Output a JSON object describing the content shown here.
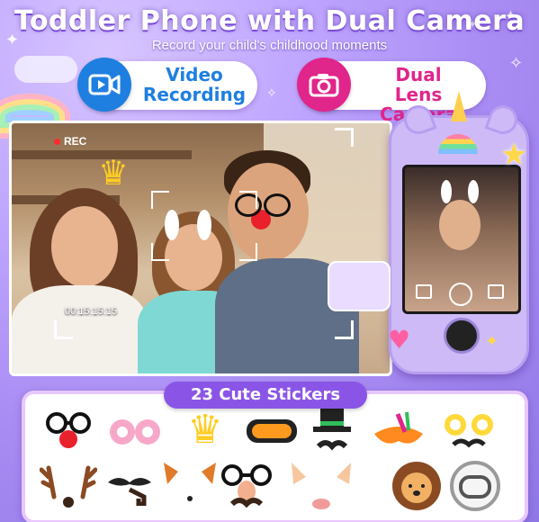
{
  "header": {
    "title": "Toddler Phone with Dual Camera",
    "subtitle": "Record your child's childhood moments"
  },
  "features": [
    {
      "label_line1": "Video",
      "label_line2": "Recording",
      "icon": "video-camera-icon",
      "accent": "#1e7fe0"
    },
    {
      "label_line1": "Dual",
      "label_line2": "Lens Camera",
      "icon": "camera-icon",
      "accent": "#e0258b"
    }
  ],
  "viewfinder": {
    "rec_label": "REC",
    "timecode": "00:15:15:15"
  },
  "stickers": {
    "title": "23 Cute Stickers",
    "items": [
      "glasses-clown-nose-sticker",
      "donut-glasses-sticker",
      "crown-sticker",
      "ski-goggles-sticker",
      "hat-mustache-sticker",
      "carnival-mask-sticker",
      "chick-glasses-sticker",
      "reindeer-antlers-sticker",
      "mustache-pipe-sticker",
      "fox-ears-sticker",
      "glasses-nose-mustache-sticker",
      "bunny-ears-sticker",
      "lion-mane-sticker",
      "astronaut-helmet-sticker"
    ]
  },
  "colors": {
    "background": "#a98cf3",
    "title_shadow": "#7a4bd8",
    "stickers_banner": "#8a55e6",
    "phone_body": "#cdbaf7"
  }
}
